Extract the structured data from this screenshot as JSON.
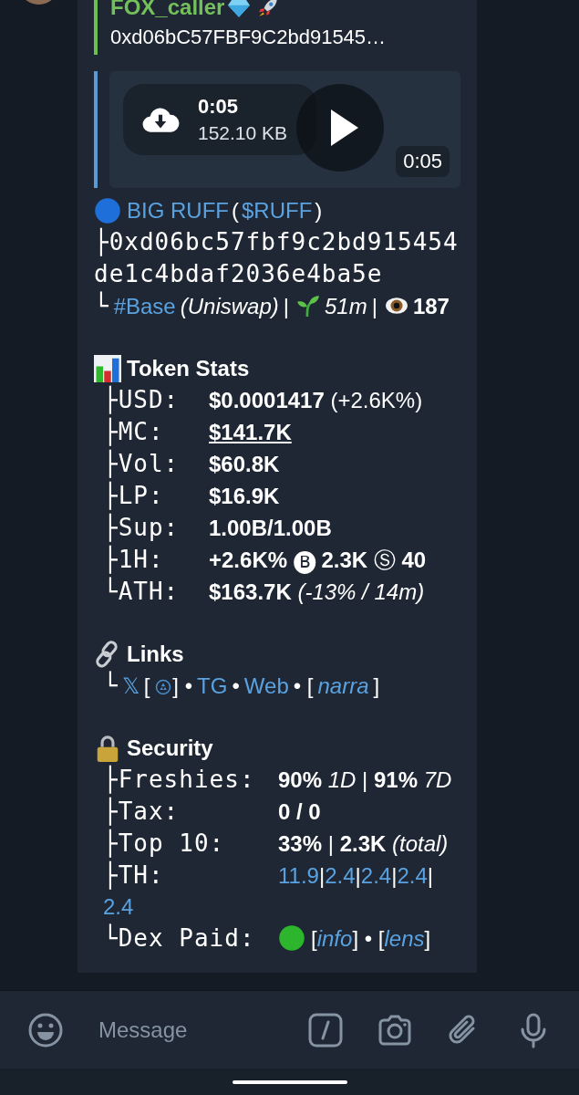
{
  "reply": {
    "sender": "FOX_caller",
    "text": "0xd06bC57FBF9C2bd91545…"
  },
  "media": {
    "duration": "0:05",
    "size": "152.10 KB",
    "badge": "0:05"
  },
  "token": {
    "title": [
      {
        "kind": "link",
        "t": "BIG RUFF"
      },
      {
        "kind": "text",
        "t": "("
      },
      {
        "kind": "link",
        "t": "$RUFF"
      },
      {
        "kind": "text",
        "t": ")"
      }
    ],
    "address_tree": "├",
    "address": "0xd06bc57fbf9c2bd915454de1c4bdaf2036e4ba5e",
    "meta_tree": "└",
    "chain": "#Base",
    "dex": "(Uniswap)",
    "sep": "|",
    "age": "51m",
    "views": "187"
  },
  "sections": [
    {
      "kind": "stats",
      "heading": "Token Stats",
      "rows": [
        {
          "tree": "├",
          "label": "USD:",
          "value": [
            {
              "kind": "text",
              "t": "**$0.0001417** (+2.6K%)"
            }
          ]
        },
        {
          "tree": "├",
          "label": "MC:",
          "value": [
            {
              "kind": "underlined",
              "t": "**$141.7K**"
            }
          ]
        },
        {
          "tree": "├",
          "label": "Vol:",
          "value": [
            {
              "kind": "text",
              "t": "**$60.8K**"
            }
          ]
        },
        {
          "tree": "├",
          "label": "LP:",
          "value": [
            {
              "kind": "text",
              "t": "**$16.9K**"
            }
          ]
        },
        {
          "tree": "├",
          "label": "Sup:",
          "value": [
            {
              "kind": "text",
              "t": "**1.00B/1.00B**"
            }
          ]
        },
        {
          "tree": "├",
          "label": "1H:",
          "value": [
            {
              "kind": "text",
              "t": "**+2.6K%** 🅑 **2.3K** Ⓢ **40**"
            }
          ]
        },
        {
          "tree": "└",
          "label": "ATH:",
          "value": [
            {
              "kind": "text",
              "t": "**$163.7K** *(-13% / 14m)*"
            }
          ]
        }
      ]
    },
    {
      "kind": "links",
      "heading": "Links",
      "rows": [
        {
          "tree": "└",
          "label": "",
          "value": [
            {
              "kind": "link",
              "t": "𝕏"
            },
            {
              "kind": "text",
              "t": "["
            },
            {
              "kind": "icon"
            },
            {
              "kind": "text",
              "t": "] •"
            },
            {
              "kind": "link",
              "t": "TG"
            },
            {
              "kind": "text",
              "t": "•"
            },
            {
              "kind": "link",
              "t": "Web"
            },
            {
              "kind": "text",
              "t": "• ["
            },
            {
              "kind": "link",
              "t": "*narra*"
            },
            {
              "kind": "text",
              "t": "]"
            }
          ]
        }
      ]
    },
    {
      "kind": "security",
      "heading": "Security",
      "rows": [
        {
          "tree": "├",
          "label": "Freshies:",
          "value": [
            {
              "kind": "text",
              "t": "**90%** *1D* | **91%** *7D*"
            }
          ]
        },
        {
          "tree": "├",
          "label": "Tax:",
          "value": [
            {
              "kind": "text",
              "t": "**0 / 0**"
            }
          ]
        },
        {
          "tree": "├",
          "label": "Top 10:",
          "value": [
            {
              "kind": "text",
              "t": "**33%** | **2.3K** *(total)*"
            }
          ]
        },
        {
          "tree": "├",
          "label": "TH:",
          "value": [
            {
              "kind": "link",
              "t": "11.9"
            },
            {
              "kind": "text",
              "t": "|"
            },
            {
              "kind": "link",
              "t": "2.4"
            },
            {
              "kind": "text",
              "t": "|"
            },
            {
              "kind": "link",
              "t": "2.4"
            },
            {
              "kind": "text",
              "t": "|"
            },
            {
              "kind": "link",
              "t": "2.4"
            },
            {
              "kind": "text",
              "t": "|"
            },
            {
              "kind": "link",
              "t": "2.4"
            }
          ]
        },
        {
          "tree": "└",
          "label": "Dex Paid:",
          "value": [
            {
              "kind": "status",
              "paid": true
            },
            {
              "kind": "text",
              "t": "["
            },
            {
              "kind": "link",
              "t": "*info*"
            },
            {
              "kind": "text",
              "t": "] • ["
            },
            {
              "kind": "link",
              "t": "*lens*"
            },
            {
              "kind": "text",
              "t": "]"
            }
          ]
        }
      ]
    }
  ],
  "composer": {
    "placeholder": "Message"
  }
}
